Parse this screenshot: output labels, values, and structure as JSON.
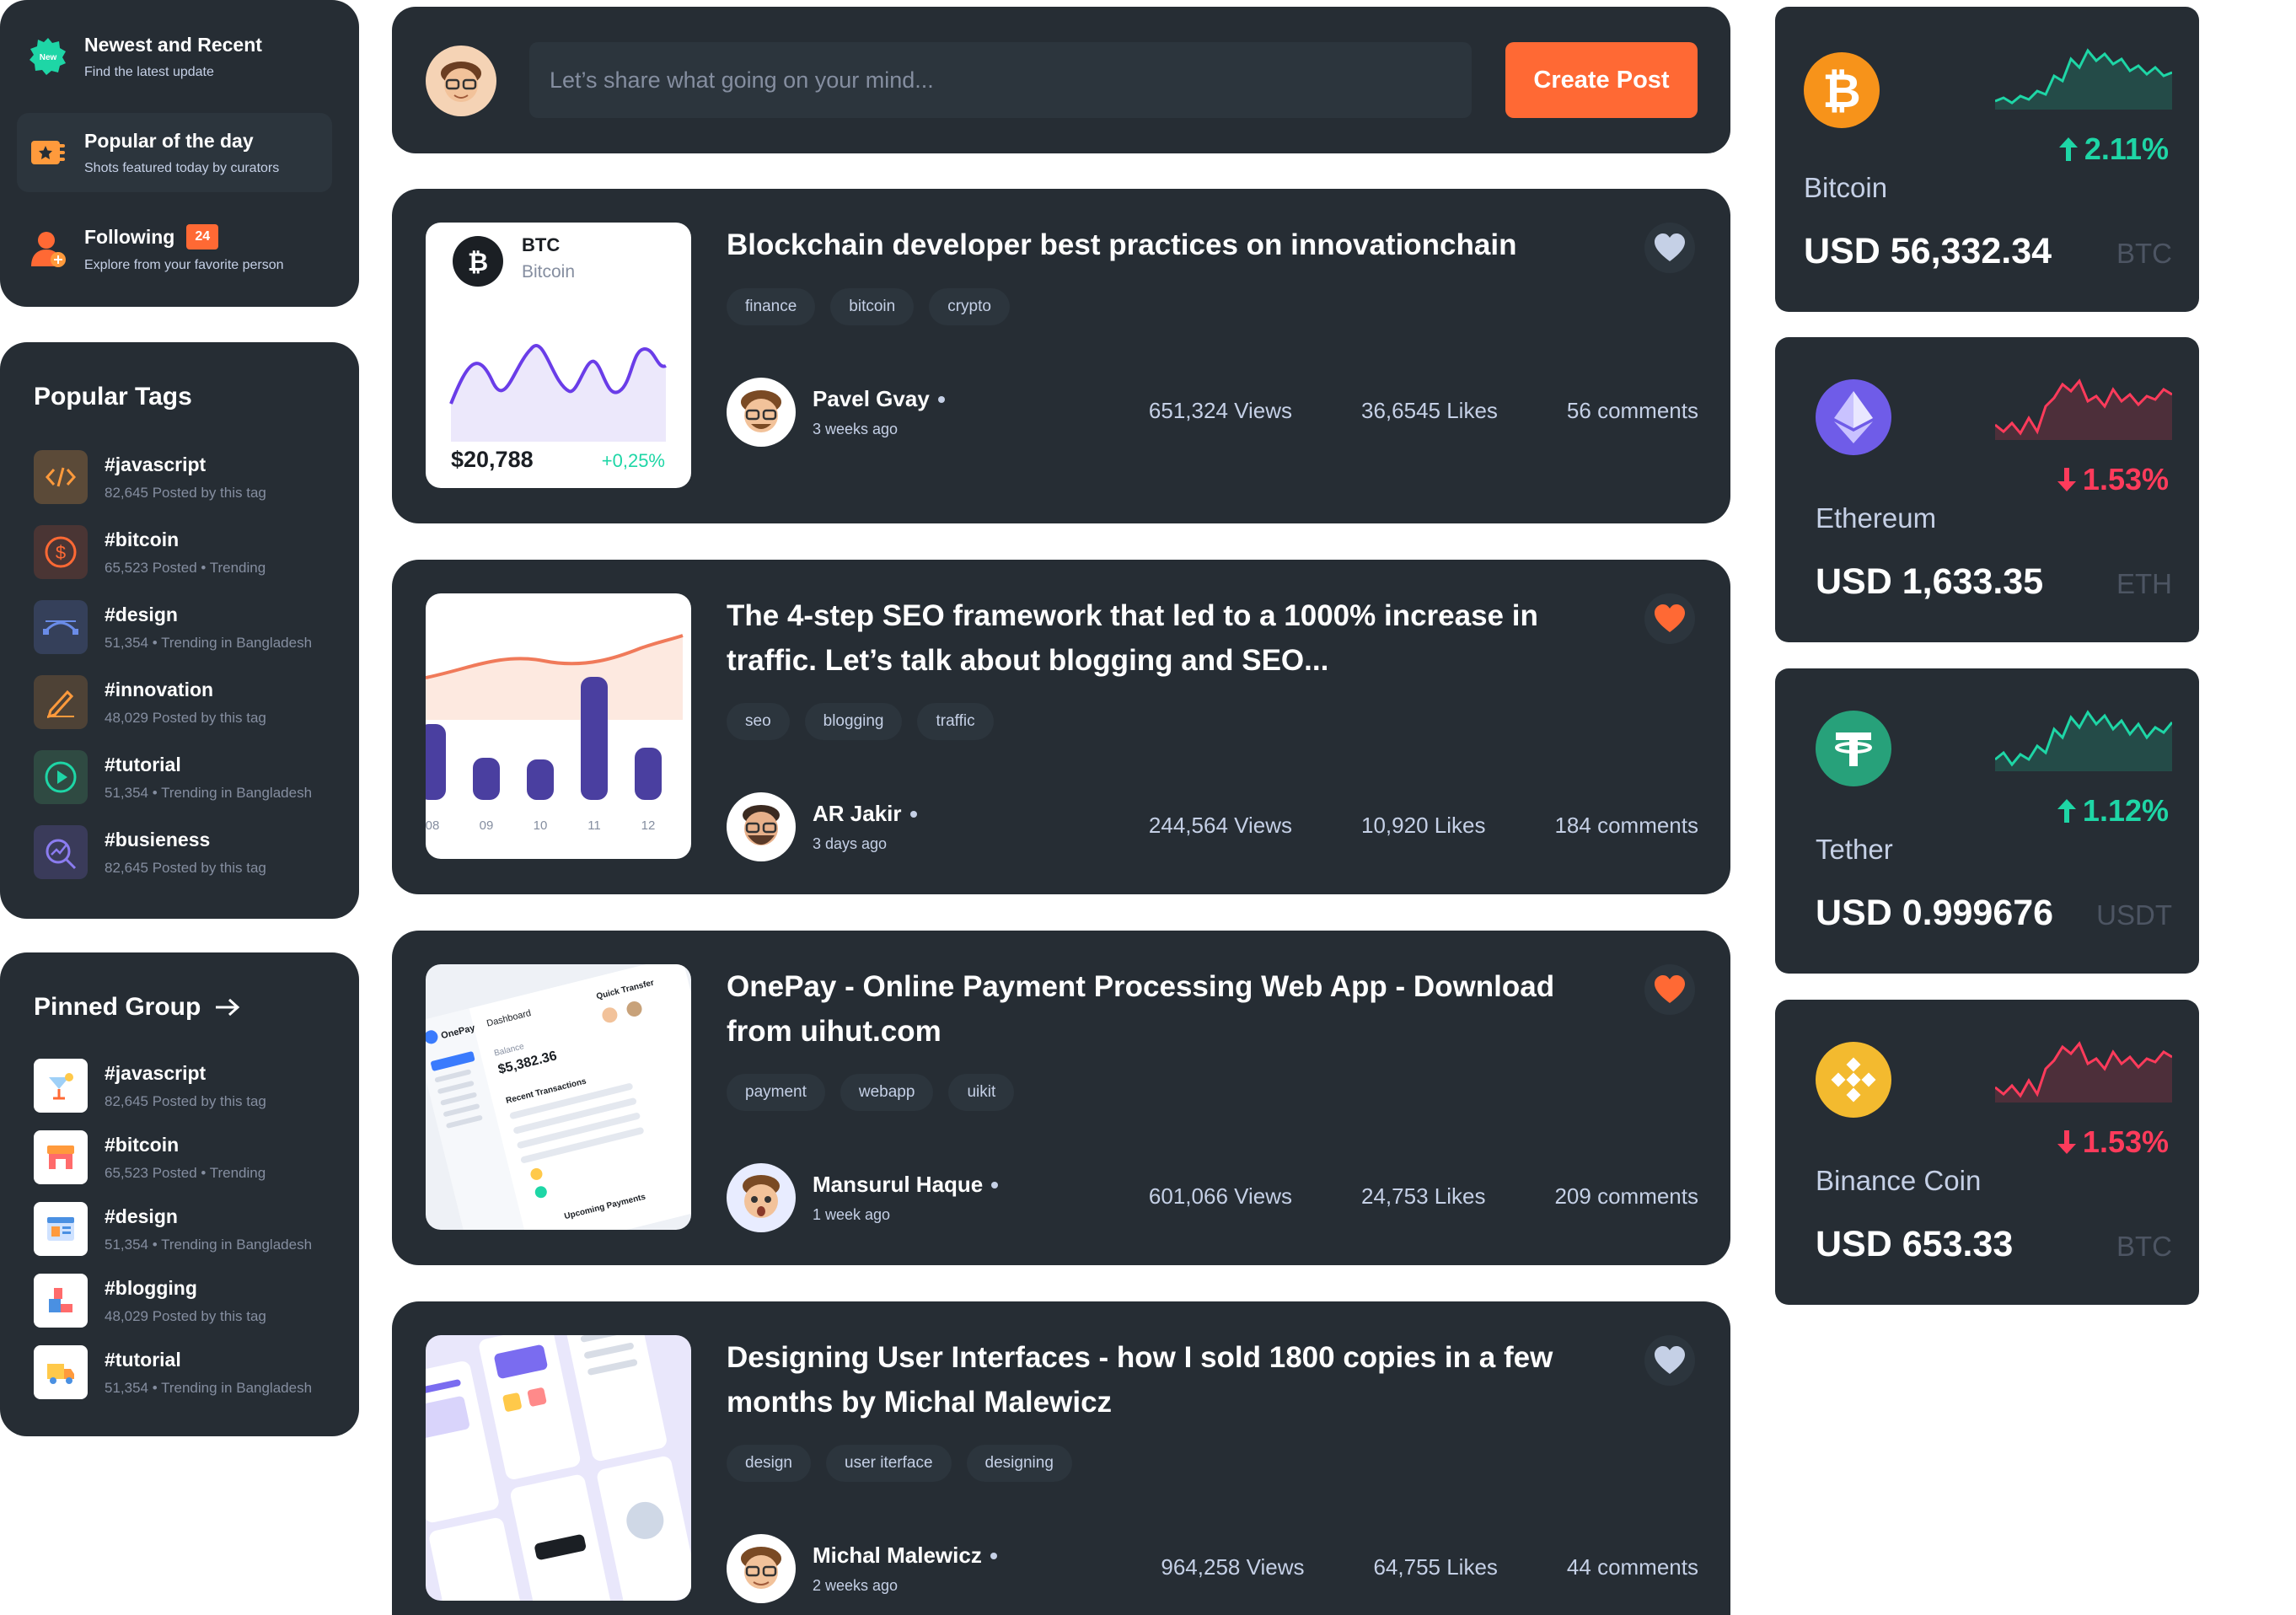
{
  "sidebar": {
    "feed": [
      {
        "title": "Newest and Recent",
        "subtitle": "Find the latest update",
        "icon": "new-badge-icon",
        "badge_text": "New"
      },
      {
        "title": "Popular of the day",
        "subtitle": "Shots featured today by curators",
        "icon": "ticket-star-icon"
      },
      {
        "title": "Following",
        "subtitle": "Explore from your favorite person",
        "icon": "user-add-icon",
        "count": "24"
      }
    ],
    "popular_tags": {
      "title": "Popular Tags",
      "items": [
        {
          "name": "#javascript",
          "meta": "82,645 Posted by this tag",
          "icon": "code-icon"
        },
        {
          "name": "#bitcoin",
          "meta": "65,523 Posted • Trending",
          "icon": "dollar-coin-icon"
        },
        {
          "name": "#design",
          "meta": "51,354 • Trending in Bangladesh",
          "icon": "bezier-icon"
        },
        {
          "name": "#innovation",
          "meta": "48,029 Posted by this tag",
          "icon": "pen-icon"
        },
        {
          "name": "#tutorial",
          "meta": "51,354 • Trending in Bangladesh",
          "icon": "play-circle-icon"
        },
        {
          "name": "#busieness",
          "meta": "82,645 Posted by this tag",
          "icon": "chart-search-icon"
        }
      ]
    },
    "pinned_group": {
      "title": "Pinned Group",
      "items": [
        {
          "name": "#javascript",
          "meta": "82,645 Posted by this tag",
          "icon": "cocktail-icon"
        },
        {
          "name": "#bitcoin",
          "meta": "65,523 Posted • Trending",
          "icon": "shop-icon"
        },
        {
          "name": "#design",
          "meta": "51,354 • Trending in Bangladesh",
          "icon": "browser-window-icon"
        },
        {
          "name": "#blogging",
          "meta": "48,029 Posted by this tag",
          "icon": "blocks-icon"
        },
        {
          "name": "#tutorial",
          "meta": "51,354 • Trending in Bangladesh",
          "icon": "truck-icon"
        }
      ]
    }
  },
  "composer": {
    "placeholder": "Let’s share what going on your mind...",
    "button": "Create Post"
  },
  "btc_thumb": {
    "symbol": "BTC",
    "name": "Bitcoin",
    "price": "$20,788",
    "change": "+0,25%"
  },
  "seo_thumb": {
    "labels": [
      "08",
      "09",
      "10",
      "11",
      "12"
    ],
    "values": [
      0.45,
      0.25,
      0.24,
      0.73,
      0.31
    ]
  },
  "posts": [
    {
      "title": "Blockchain developer best practices on innovationchain",
      "tags": [
        "finance",
        "bitcoin",
        "crypto"
      ],
      "author": "Pavel Gvay",
      "time": "3 weeks ago",
      "views": "651,324 Views",
      "likes": "36,6545 Likes",
      "comments": "56 comments",
      "liked": false
    },
    {
      "title": "The 4-step SEO framework that led to a 1000% increase in traffic. Let’s talk about blogging and SEO...",
      "tags": [
        "seo",
        "blogging",
        "traffic"
      ],
      "author": "AR Jakir",
      "time": "3 days ago",
      "views": "244,564 Views",
      "likes": "10,920 Likes",
      "comments": "184 comments",
      "liked": true
    },
    {
      "title": "OnePay - Online Payment Processing Web App - Download from uihut.com",
      "tags": [
        "payment",
        "webapp",
        "uikit"
      ],
      "author": "Mansurul Haque",
      "time": "1 week ago",
      "views": "601,066 Views",
      "likes": "24,753 Likes",
      "comments": "209 comments",
      "liked": true
    },
    {
      "title": "Designing User Interfaces - how I sold 1800 copies in a few months by Michal Malewicz",
      "tags": [
        "design",
        "user iterface",
        "designing"
      ],
      "author": "Michal Malewicz",
      "time": "2 weeks ago",
      "views": "964,258 Views",
      "likes": "64,755 Likes",
      "comments": "44 comments",
      "liked": false
    }
  ],
  "onepay_thumb": {
    "app": "OnePay",
    "tab": "Dashboard",
    "balance_label": "Balance",
    "balance": "$5,382.36",
    "section": "Recent Transactions",
    "transfer": "Quick Transfer",
    "upcoming": "Upcoming Payments"
  },
  "coins": [
    {
      "name": "Bitcoin",
      "price": "USD 56,332.34",
      "symbol": "BTC",
      "change": "2.11%",
      "direction": "up",
      "color": "#f7931a",
      "icon": "bitcoin-icon"
    },
    {
      "name": "Ethereum",
      "price": "USD 1,633.35",
      "symbol": "ETH",
      "change": "1.53%",
      "direction": "down",
      "color": "#6f5ce8",
      "icon": "ethereum-icon"
    },
    {
      "name": "Tether",
      "price": "USD 0.999676",
      "symbol": "USDT",
      "change": "1.12%",
      "direction": "up",
      "color": "#27a17a",
      "icon": "tether-icon"
    },
    {
      "name": "Binance Coin",
      "price": "USD 653.33",
      "symbol": "BTC",
      "change": "1.53%",
      "direction": "down",
      "color": "#f3ba2f",
      "icon": "binance-icon"
    }
  ],
  "colors": {
    "panel": "#262d34",
    "accent": "#ff6934",
    "up": "#1ed6a6",
    "down": "#ff3b5b"
  }
}
